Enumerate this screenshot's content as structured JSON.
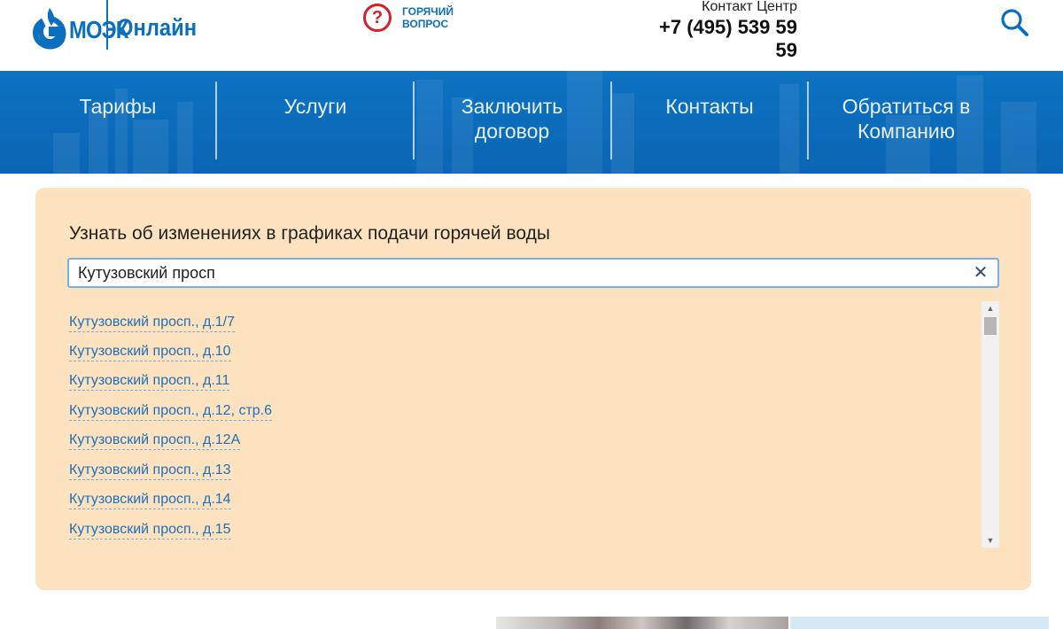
{
  "header": {
    "logo": {
      "mark_letter": "G",
      "name": "МОЭК",
      "subtitle": "Онлайн"
    },
    "hot_question": {
      "label": "ГОРЯЧИЙ ВОПРОС",
      "icon": "question-circle-icon"
    },
    "contact": {
      "label": "Контакт Центр",
      "phone": "+7 (495) 539 59 59"
    },
    "search": {
      "icon": "search-icon"
    }
  },
  "nav": {
    "items": [
      {
        "label": "Тарифы"
      },
      {
        "label": "Услуги"
      },
      {
        "label": "Заключить договор"
      },
      {
        "label": "Контакты"
      },
      {
        "label": "Обратиться в Компанию"
      }
    ]
  },
  "search_panel": {
    "title": "Узнать об изменениях в графиках подачи горячей воды",
    "input_value": "Кутузовский просп",
    "clear_icon": "close-icon",
    "results": [
      "Кутузовский просп., д.1/7",
      "Кутузовский просп., д.10",
      "Кутузовский просп., д.11",
      "Кутузовский просп., д.12, стр.6",
      "Кутузовский просп., д.12А",
      "Кутузовский просп., д.13",
      "Кутузовский просп., д.14",
      "Кутузовский просп., д.15"
    ]
  },
  "colors": {
    "brand_blue": "#0b6fc0",
    "nav_blue": "#0d72c2",
    "panel_bg": "#fde2bf",
    "link_blue": "#1f6fba",
    "accent_red": "#d2212c"
  }
}
